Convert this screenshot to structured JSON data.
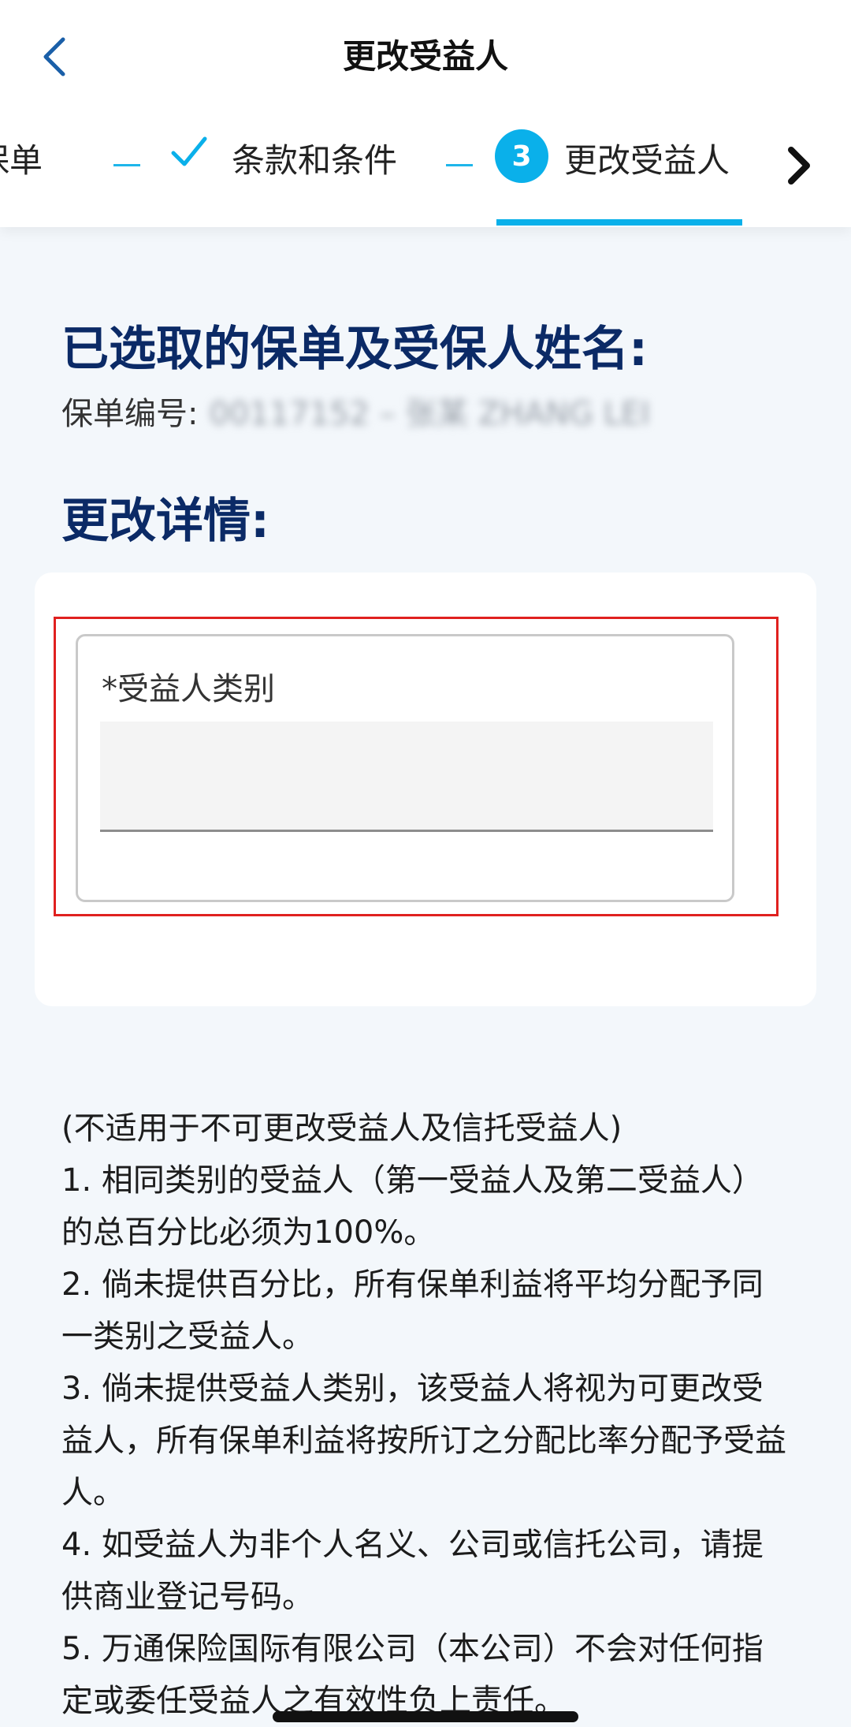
{
  "header": {
    "title": "更改受益人"
  },
  "steps": [
    {
      "label": "保单",
      "state": "done"
    },
    {
      "label": "条款和条件",
      "state": "done"
    },
    {
      "label": "更改受益人",
      "number": "3",
      "state": "active"
    }
  ],
  "selected": {
    "heading": "已选取的保单及受保人姓名:",
    "policy_label": "保单编号:",
    "policy_value": "00117152 – 张某 ZHANG LEI"
  },
  "change": {
    "heading": "更改详情:",
    "field_label": "*受益人类别",
    "field_value": ""
  },
  "notes": [
    "(不适用于不可更改受益人及信托受益人)",
    "1. 相同类别的受益人（第一受益人及第二受益人）的总百分比必须为100%。",
    "2. 倘未提供百分比，所有保单利益将平均分配予同一类别之受益人。",
    "3. 倘未提供受益人类别，该受益人将视为可更改受益人，所有保单利益将按所订之分配比率分配予受益人。",
    "4. 如受益人为非个人名义、公司或信托公司，请提供商业登记号码。",
    "5. 万通保险国际有限公司（本公司）不会对任何指定或委任受益人之有效性负上责任。"
  ],
  "colors": {
    "accent": "#0ab0ea",
    "heading": "#0b2a66",
    "highlight_border": "#e0211f"
  },
  "icons": {
    "back": "chevron-left-icon",
    "check": "check-icon",
    "next": "chevron-right-icon"
  }
}
